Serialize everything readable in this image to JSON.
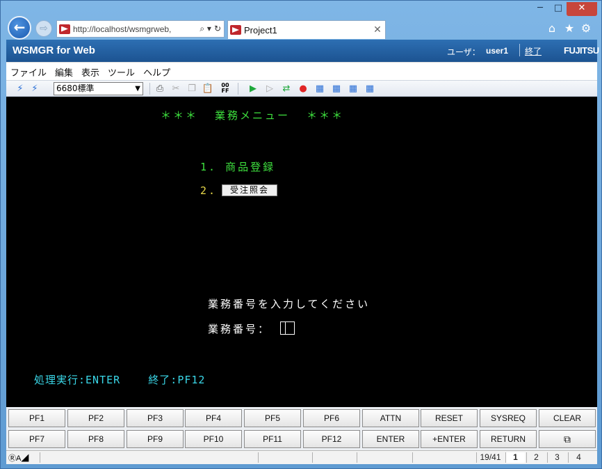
{
  "browser": {
    "address": "http://localhost/wsmgrweb,",
    "tab_title": "Project1",
    "window_min": "─",
    "window_max": "□",
    "window_close": "✕",
    "back_glyph": "←",
    "forward_glyph": "⇨",
    "search_glyph": "⌕ ▾",
    "refresh_glyph": "↻",
    "tab_close_glyph": "✕"
  },
  "header": {
    "title": "WSMGR for Web",
    "user_label": "ユーザ：",
    "user_name": "user1",
    "logout": "終了",
    "logo": "FUJITSU"
  },
  "menu": [
    "ファイル",
    "編集",
    "表示",
    "ツール",
    "ヘルプ"
  ],
  "toolbar": {
    "session_type": "6680標準",
    "icons": [
      "connect-icon",
      "disconnect-icon",
      "print-icon",
      "cut-icon",
      "copy-icon",
      "paste-icon",
      "ff-icon",
      "play-icon",
      "step-icon",
      "repeat-icon",
      "record-icon",
      "macro1-icon",
      "macro2-icon",
      "macro3-icon",
      "macro4-icon"
    ]
  },
  "terminal": {
    "title": "＊＊＊  業務メニュー  ＊＊＊",
    "item1": "1. 商品登録",
    "item2_num": "2.",
    "item2_label": "受注照会",
    "prompt": "業務番号を入力してください",
    "field_label": "業務番号：",
    "footer": "処理実行:ENTER    終了:PF12"
  },
  "pf_keys": {
    "row1": [
      "PF1",
      "PF2",
      "PF3",
      "PF4",
      "PF5",
      "PF6",
      "ATTN",
      "RESET",
      "SYSREQ",
      "CLEAR"
    ],
    "row2": [
      "PF7",
      "PF8",
      "PF9",
      "PF10",
      "PF11",
      "PF12",
      "ENTER",
      "+ENTER",
      "RETURN",
      "⧉"
    ]
  },
  "status": {
    "mode": "ⓇA◢",
    "cursor_pos": "19/41",
    "sessions": [
      "1",
      "2",
      "3",
      "4"
    ]
  },
  "colors": {
    "terminal_bg": "#000000",
    "terminal_green": "#3ee03e",
    "terminal_yellow": "#e8d84a",
    "terminal_cyan": "#3ad7e8",
    "header_blue": "#1c5391"
  }
}
